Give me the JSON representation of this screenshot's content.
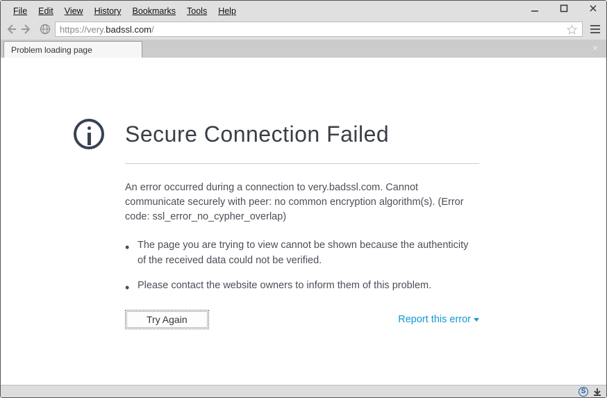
{
  "menu": {
    "file": "File",
    "edit": "Edit",
    "view": "View",
    "history": "History",
    "bookmarks": "Bookmarks",
    "tools": "Tools",
    "help": "Help"
  },
  "url": {
    "protocol": "https://",
    "sub": "very.",
    "host": "badssl.com",
    "path": "/"
  },
  "tab": {
    "title": "Problem loading page"
  },
  "error": {
    "title": "Secure Connection Failed",
    "body": "An error occurred during a connection to very.badssl.com. Cannot communicate securely with peer: no common encryption algorithm(s). (Error code: ssl_error_no_cypher_overlap)",
    "bullets": [
      "The page you are trying to view cannot be shown because the authenticity of the received data could not be verified.",
      "Please contact the website owners to inform them of this problem."
    ],
    "try_again": "Try Again",
    "report": "Report this error"
  },
  "status": {
    "s_label": "S"
  }
}
